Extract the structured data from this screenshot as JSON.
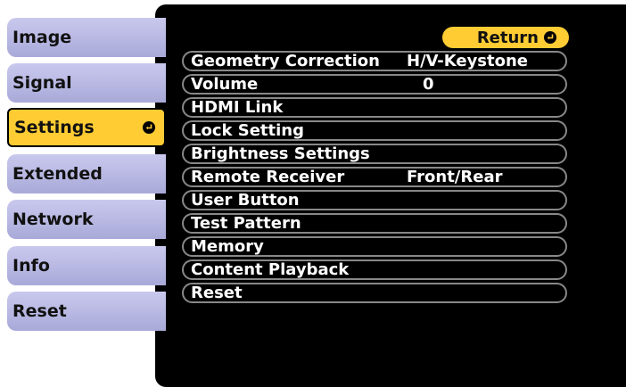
{
  "tabs": [
    {
      "label": "Image"
    },
    {
      "label": "Signal"
    },
    {
      "label": "Settings",
      "active": true
    },
    {
      "label": "Extended"
    },
    {
      "label": "Network"
    },
    {
      "label": "Info"
    },
    {
      "label": "Reset"
    }
  ],
  "return_label": "Return",
  "items": [
    {
      "label": "Geometry Correction",
      "value": "H/V-Keystone"
    },
    {
      "label": "Volume",
      "value": "0"
    },
    {
      "label": "HDMI Link",
      "value": ""
    },
    {
      "label": "Lock Setting",
      "value": ""
    },
    {
      "label": "Brightness Settings",
      "value": ""
    },
    {
      "label": "Remote Receiver",
      "value": "Front/Rear"
    },
    {
      "label": "User Button",
      "value": ""
    },
    {
      "label": "Test Pattern",
      "value": ""
    },
    {
      "label": "Memory",
      "value": ""
    },
    {
      "label": "Content Playback",
      "value": ""
    },
    {
      "label": "Reset",
      "value": ""
    }
  ],
  "colors": {
    "accent": "#ffcc33",
    "tab": "#b9b9e4",
    "panel": "#000000"
  },
  "icons": {
    "enter": "enter-icon"
  }
}
